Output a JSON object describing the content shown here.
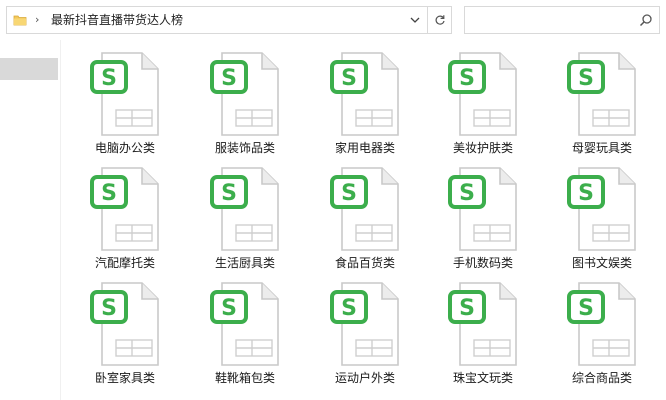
{
  "address": {
    "separator": "›",
    "path": "最新抖音直播带货达人榜"
  },
  "search": {
    "placeholder": ""
  },
  "colors": {
    "accent": "#3cae4c",
    "doc_outline": "#c9c9c9"
  },
  "files": [
    {
      "name": "电脑办公类",
      "icon": "spreadsheet-icon"
    },
    {
      "name": "服装饰品类",
      "icon": "spreadsheet-icon"
    },
    {
      "name": "家用电器类",
      "icon": "spreadsheet-icon"
    },
    {
      "name": "美妆护肤类",
      "icon": "spreadsheet-icon"
    },
    {
      "name": "母婴玩具类",
      "icon": "spreadsheet-icon"
    },
    {
      "name": "汽配摩托类",
      "icon": "spreadsheet-icon"
    },
    {
      "name": "生活厨具类",
      "icon": "spreadsheet-icon"
    },
    {
      "name": "食品百货类",
      "icon": "spreadsheet-icon"
    },
    {
      "name": "手机数码类",
      "icon": "spreadsheet-icon"
    },
    {
      "name": "图书文娱类",
      "icon": "spreadsheet-icon"
    },
    {
      "name": "卧室家具类",
      "icon": "spreadsheet-icon"
    },
    {
      "name": "鞋靴箱包类",
      "icon": "spreadsheet-icon"
    },
    {
      "name": "运动户外类",
      "icon": "spreadsheet-icon"
    },
    {
      "name": "珠宝文玩类",
      "icon": "spreadsheet-icon"
    },
    {
      "name": "综合商品类",
      "icon": "spreadsheet-icon"
    }
  ]
}
